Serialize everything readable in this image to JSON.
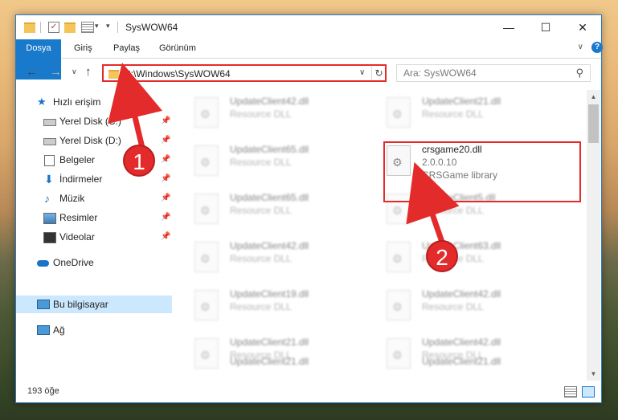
{
  "window": {
    "title": "SysWOW64",
    "minimize_label": "—",
    "maximize_label": "☐",
    "close_label": "✕"
  },
  "menu": {
    "file": "Dosya",
    "items": [
      "Giriş",
      "Paylaş",
      "Görünüm"
    ],
    "expand_glyph": "∨",
    "help_glyph": "?"
  },
  "nav": {
    "back_glyph": "←",
    "forward_glyph": "→",
    "recent_glyph": "∨",
    "up_glyph": "↑",
    "address": "C:\\Windows\\SysWOW64",
    "address_dropdown": "∨",
    "refresh_glyph": "↻",
    "search_placeholder": "Ara: SysWOW64",
    "search_glyph": "⚲"
  },
  "sidebar": {
    "items": [
      {
        "label": "Hızlı erişim",
        "icon": "star-icon",
        "pinned": false
      },
      {
        "label": "Yerel Disk (C:)",
        "icon": "drive-icon",
        "pinned": true
      },
      {
        "label": "Yerel Disk (D:)",
        "icon": "drive-icon",
        "pinned": true
      },
      {
        "label": "Belgeler",
        "icon": "documents-icon",
        "pinned": true
      },
      {
        "label": "İndirmeler",
        "icon": "downloads-icon",
        "pinned": true
      },
      {
        "label": "Müzik",
        "icon": "music-icon",
        "pinned": true
      },
      {
        "label": "Resimler",
        "icon": "pictures-icon",
        "pinned": true
      },
      {
        "label": "Videolar",
        "icon": "videos-icon",
        "pinned": true
      },
      {
        "label": "OneDrive",
        "icon": "onedrive-icon",
        "pinned": false
      },
      {
        "label": "Bu bilgisayar",
        "icon": "this-pc-icon",
        "pinned": false,
        "selected": true
      },
      {
        "label": "Ağ",
        "icon": "network-icon",
        "pinned": false
      }
    ],
    "pin_glyph": "📌"
  },
  "files": {
    "col1": [
      {
        "name": "UpdateClient42.dll",
        "desc": "Resource DLL"
      },
      {
        "name": "UpdateClient65.dll",
        "desc": "Resource DLL"
      },
      {
        "name": "UpdateClient65.dll",
        "desc": "Resource DLL"
      },
      {
        "name": "UpdateClient42.dll",
        "desc": "Resource DLL"
      },
      {
        "name": "UpdateClient19.dll",
        "desc": "Resource DLL"
      },
      {
        "name": "UpdateClient21.dll",
        "desc": "Resource DLL"
      },
      {
        "name": "UpdateClient21.dll",
        "desc": "Resource DLL"
      }
    ],
    "col2": [
      {
        "name": "UpdateClient21.dll",
        "desc": "Resource DLL"
      },
      {
        "name": "crsgame20.dll",
        "desc": "2.0.0.10",
        "desc2": "CRSGame library",
        "highlight": true
      },
      {
        "name": "UpdateClient5.dll",
        "desc": "Resource DLL"
      },
      {
        "name": "UpdateClient63.dll",
        "desc": "Resource DLL"
      },
      {
        "name": "UpdateClient42.dll",
        "desc": "Resource DLL"
      },
      {
        "name": "UpdateClient42.dll",
        "desc": "Resource DLL"
      },
      {
        "name": "UpdateClient21.dll",
        "desc": "Resource DLL"
      }
    ]
  },
  "status": {
    "count": "193 öğe"
  },
  "callouts": [
    "1",
    "2"
  ],
  "colors": {
    "accent": "#1979ca",
    "highlight": "#e32b2b"
  }
}
